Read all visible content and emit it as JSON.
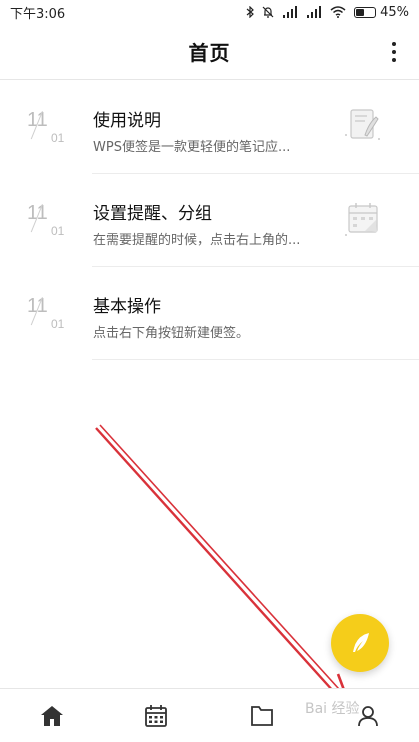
{
  "status_bar": {
    "time": "下午3:06",
    "battery_percent": "45%",
    "battery_level": 0.45
  },
  "header": {
    "title": "首页"
  },
  "notes": [
    {
      "month": "11",
      "day": "01",
      "title": "使用说明",
      "snippet": "WPS便签是一款更轻便的笔记应...",
      "thumb_icon": "note-pen-icon"
    },
    {
      "month": "11",
      "day": "01",
      "title": "设置提醒、分组",
      "snippet": "在需要提醒的时候，点击右上角的...",
      "thumb_icon": "calendar-icon"
    },
    {
      "month": "11",
      "day": "01",
      "title": "基本操作",
      "snippet": "点击右下角按钮新建便签。",
      "thumb_icon": ""
    }
  ],
  "fab": {
    "icon": "feather-icon"
  },
  "tabs": [
    {
      "icon": "home-icon",
      "active": true
    },
    {
      "icon": "calendar-icon",
      "active": false
    },
    {
      "icon": "folder-icon",
      "active": false
    },
    {
      "icon": "user-icon",
      "active": false
    }
  ],
  "watermark": {
    "text": "Bai 经验"
  },
  "colors": {
    "accent": "#f5cd1a",
    "annotation_arrow": "#d9323a"
  }
}
